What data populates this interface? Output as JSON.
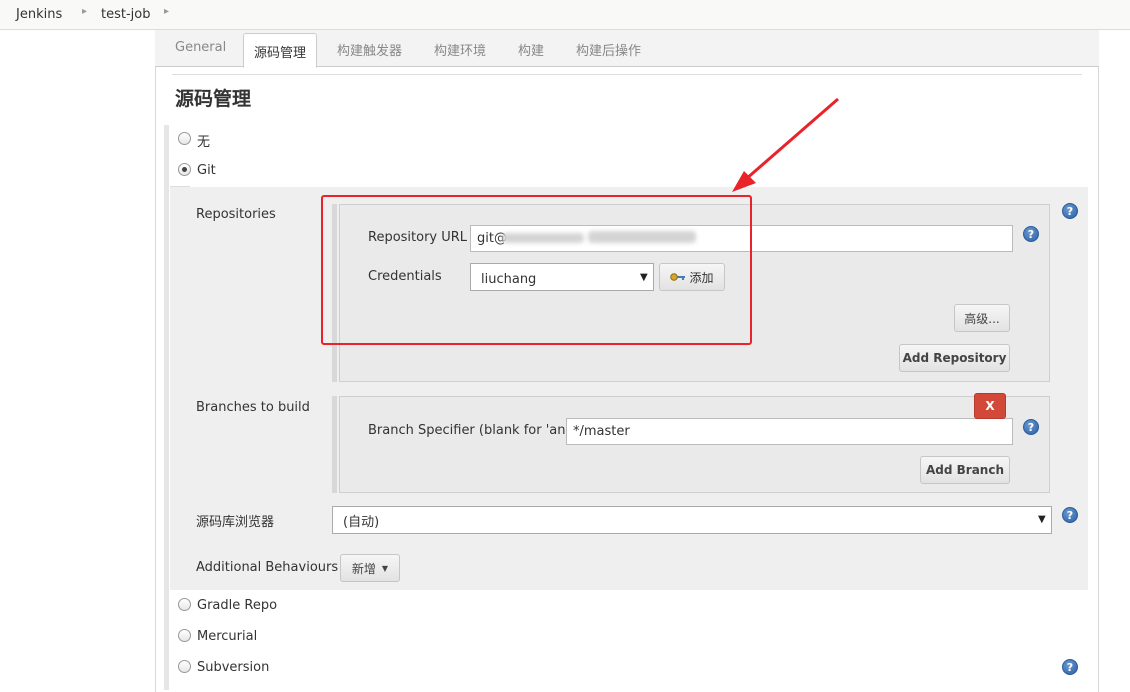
{
  "breadcrumb": [
    "Jenkins",
    "test-job"
  ],
  "tabs": [
    "General",
    "源码管理",
    "构建触发器",
    "构建环境",
    "构建",
    "构建后操作"
  ],
  "active_tab": "源码管理",
  "section_title": "源码管理",
  "scm_options": {
    "none": "无",
    "git": "Git",
    "gradle": "Gradle Repo",
    "mercurial": "Mercurial",
    "subversion": "Subversion"
  },
  "selected_scm": "Git",
  "repositories": {
    "label": "Repositories",
    "url_label": "Repository URL",
    "url_value": "git@",
    "credentials_label": "Credentials",
    "credentials_value": "liuchang",
    "add_label": "添加",
    "advanced_label": "高级...",
    "add_repository_label": "Add Repository"
  },
  "branches": {
    "label": "Branches to build",
    "specifier_label": "Branch Specifier (blank for 'any')",
    "specifier_value": "*/master",
    "delete_label": "X",
    "add_branch_label": "Add Branch"
  },
  "browser": {
    "label": "源码库浏览器",
    "value": "(自动)"
  },
  "additional": {
    "label": "Additional Behaviours",
    "button_label": "新增"
  },
  "help_glyph": "?",
  "colors": {
    "annotation": "#e8232a",
    "delete_button": "#d24939",
    "help_icon": "#2a5d9f"
  }
}
